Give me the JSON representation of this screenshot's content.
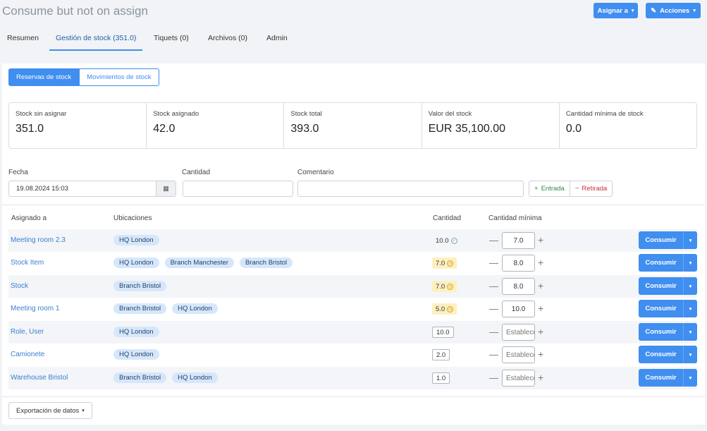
{
  "page": {
    "title": "Consume but not on assign"
  },
  "header": {
    "assign_label": "Asignar a",
    "actions_label": "Acciones"
  },
  "tabs": [
    {
      "label": "Resumen"
    },
    {
      "label": "Gestión de stock (351.0)"
    },
    {
      "label": "Tiquets (0)"
    },
    {
      "label": "Archivos (0)"
    },
    {
      "label": "Admin"
    }
  ],
  "subtabs": [
    {
      "label": "Reservas de stock"
    },
    {
      "label": "Movimientos de stock"
    }
  ],
  "stats": [
    {
      "label": "Stock sin asignar",
      "value": "351.0"
    },
    {
      "label": "Stock asignado",
      "value": "42.0"
    },
    {
      "label": "Stock total",
      "value": "393.0"
    },
    {
      "label": "Valor del stock",
      "value": "EUR 35,100.00"
    },
    {
      "label": "Cantidad mínima de stock",
      "value": "0.0"
    }
  ],
  "form": {
    "date_label": "Fecha",
    "date_value": "19.08.2024 15:03",
    "quantity_label": "Cantidad",
    "comment_label": "Comentario",
    "in_label": "Entrada",
    "out_label": "Retirada"
  },
  "table": {
    "headers": {
      "assigned": "Asignado a",
      "locations": "Ubicaciones",
      "quantity": "Cantidad",
      "min_quantity": "Cantidad mínima"
    },
    "consume_label": "Consumir",
    "min_placeholder": "Establecer",
    "rows": [
      {
        "assigned": "Meeting room 2.3",
        "locations": [
          "HQ London"
        ],
        "quantity": "10.0",
        "status": "ok",
        "min": "7.0"
      },
      {
        "assigned": "Stock Item",
        "locations": [
          "HQ London",
          "Branch Manchester",
          "Branch Bristol"
        ],
        "quantity": "7.0",
        "status": "warn",
        "min": "8.0"
      },
      {
        "assigned": "Stock",
        "locations": [
          "Branch Bristol"
        ],
        "quantity": "7.0",
        "status": "warn",
        "min": "8.0"
      },
      {
        "assigned": "Meeting room 1",
        "locations": [
          "Branch Bristol",
          "HQ London"
        ],
        "quantity": "5.0",
        "status": "warn",
        "min": "10.0"
      },
      {
        "assigned": "Role, User",
        "locations": [
          "HQ London"
        ],
        "quantity": "10.0",
        "status": "none",
        "min": ""
      },
      {
        "assigned": "Camionete",
        "locations": [
          "HQ London"
        ],
        "quantity": "2.0",
        "status": "none",
        "min": ""
      },
      {
        "assigned": "Warehouse Bristol",
        "locations": [
          "Branch Bristol",
          "HQ London"
        ],
        "quantity": "1.0",
        "status": "none",
        "min": ""
      }
    ]
  },
  "footer": {
    "export_label": "Exportación de datos"
  }
}
